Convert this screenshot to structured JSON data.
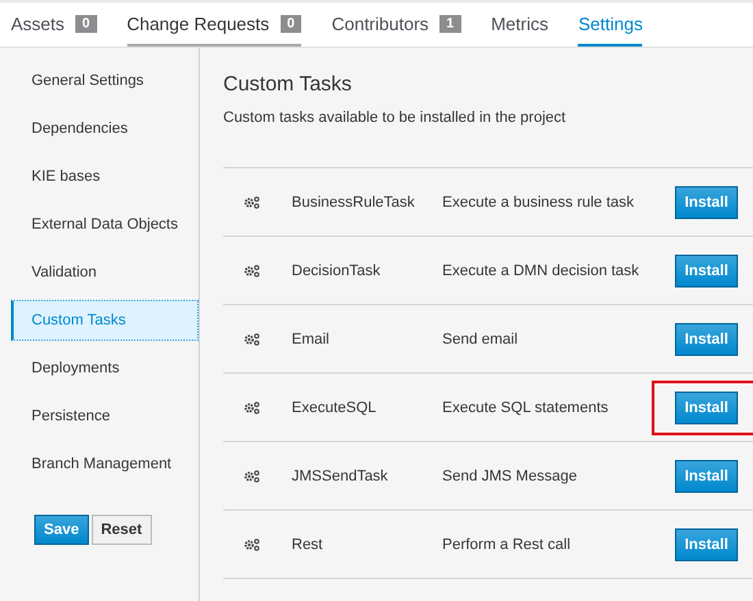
{
  "tabs": [
    {
      "label": "Assets",
      "badge": "0",
      "selected": false,
      "hovered": false
    },
    {
      "label": "Change Requests",
      "badge": "0",
      "selected": false,
      "hovered": true
    },
    {
      "label": "Contributors",
      "badge": "1",
      "selected": false,
      "hovered": false
    },
    {
      "label": "Metrics",
      "selected": false,
      "hovered": false
    },
    {
      "label": "Settings",
      "selected": true,
      "hovered": false
    }
  ],
  "sidebar": {
    "items": [
      {
        "label": "General Settings",
        "selected": false
      },
      {
        "label": "Dependencies",
        "selected": false
      },
      {
        "label": "KIE bases",
        "selected": false
      },
      {
        "label": "External Data Objects",
        "selected": false
      },
      {
        "label": "Validation",
        "selected": false
      },
      {
        "label": "Custom Tasks",
        "selected": true
      },
      {
        "label": "Deployments",
        "selected": false
      },
      {
        "label": "Persistence",
        "selected": false
      },
      {
        "label": "Branch Management",
        "selected": false
      }
    ],
    "buttons": [
      {
        "label": "Save",
        "kind": "primary"
      },
      {
        "label": "Reset",
        "kind": "default"
      }
    ]
  },
  "content": {
    "title": "Custom Tasks",
    "subtitle": "Custom tasks available to be installed in the project",
    "rows": [
      {
        "name": "BusinessRuleTask",
        "description": "Execute a business rule task",
        "button": "Install",
        "highlighted": false
      },
      {
        "name": "DecisionTask",
        "description": "Execute a DMN decision task",
        "button": "Install",
        "highlighted": false
      },
      {
        "name": "Email",
        "description": "Send email",
        "button": "Install",
        "highlighted": false
      },
      {
        "name": "ExecuteSQL",
        "description": "Execute SQL statements",
        "button": "Install",
        "highlighted": true
      },
      {
        "name": "JMSSendTask",
        "description": "Send JMS Message",
        "button": "Install",
        "highlighted": false
      },
      {
        "name": "Rest",
        "description": "Perform a Rest call",
        "button": "Install",
        "highlighted": false
      }
    ]
  }
}
